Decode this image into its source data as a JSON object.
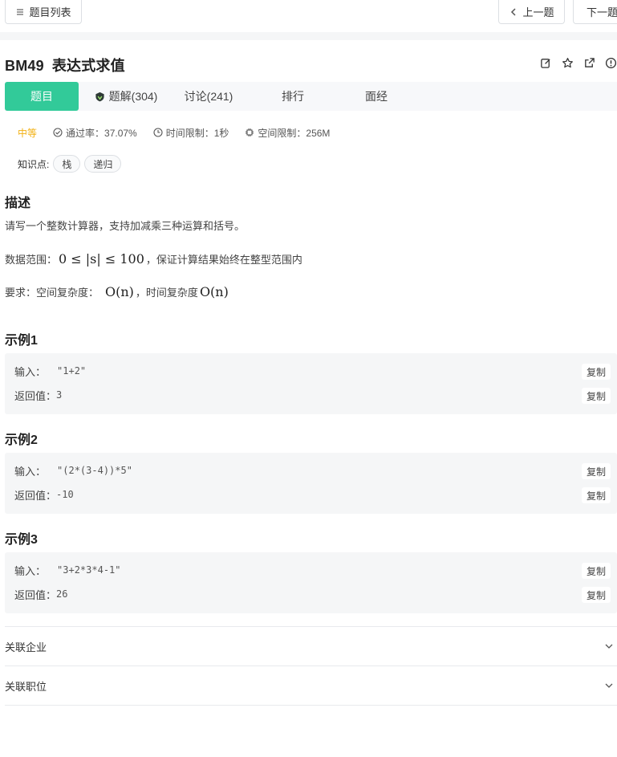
{
  "nav": {
    "list_label": "题目列表",
    "prev_label": "上一题",
    "next_label": "下一题"
  },
  "problem": {
    "code": "BM49",
    "name": "表达式求值"
  },
  "tabs": [
    {
      "label": "题目"
    },
    {
      "label": "题解(304)"
    },
    {
      "label": "讨论(241)"
    },
    {
      "label": "排行"
    },
    {
      "label": "面经"
    }
  ],
  "meta": {
    "difficulty": "中等",
    "pass_rate": "通过率：37.07%",
    "time_limit": "时间限制：1秒",
    "space_limit": "空间限制：256M"
  },
  "knowledge": {
    "label": "知识点:",
    "tags": [
      "栈",
      "递归"
    ]
  },
  "description": {
    "heading": "描述",
    "line1": "请写一个整数计算器，支持加减乘三种运算和括号。",
    "range_prefix": "数据范围：",
    "range_math": "0 ≤ |s| ≤ 100",
    "range_suffix": "，保证计算结果始终在整型范围内",
    "req_prefix": "要求：空间复杂度：",
    "req_math1": "O(n)",
    "req_mid": "，时间复杂度",
    "req_math2": "O(n)"
  },
  "examples": [
    {
      "heading": "示例1",
      "input_label": "输入：",
      "input": "\"1+2\"",
      "output_label": "返回值：",
      "output": "3"
    },
    {
      "heading": "示例2",
      "input_label": "输入：",
      "input": "\"(2*(3-4))*5\"",
      "output_label": "返回值：",
      "output": "-10"
    },
    {
      "heading": "示例3",
      "input_label": "输入：",
      "input": "\"3+2*3*4-1\"",
      "output_label": "返回值：",
      "output": "26"
    }
  ],
  "copy_label": "复制",
  "related": {
    "companies": "关联企业",
    "positions": "关联职位"
  },
  "colors": {
    "accent": "#32ca99",
    "difficulty": "#f2b011"
  }
}
